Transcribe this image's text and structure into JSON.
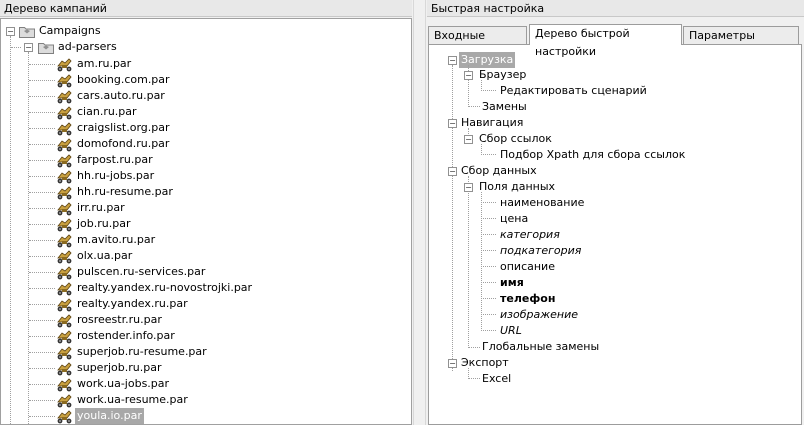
{
  "left_panel": {
    "title": "Дерево кампаний",
    "root": "Campaigns",
    "folder": "ad-parsers",
    "files": [
      "am.ru.par",
      "booking.com.par",
      "cars.auto.ru.par",
      "cian.ru.par",
      "craigslist.org.par",
      "domofond.ru.par",
      "farpost.ru.par",
      "hh.ru-jobs.par",
      "hh.ru-resume.par",
      "irr.ru.par",
      "job.ru.par",
      "m.avito.ru.par",
      "olx.ua.par",
      "pulscen.ru-services.par",
      "realty.yandex.ru-novostrojki.par",
      "realty.yandex.ru.par",
      "rosreestr.ru.par",
      "rostender.info.par",
      "superjob.ru-resume.par",
      "superjob.ru.par",
      "work.ua-jobs.par",
      "work.ua-resume.par",
      "youla.io.par"
    ],
    "selected_file": "youla.io.par"
  },
  "right_panel": {
    "title": "Быстрая настройка",
    "tabs": [
      "Входные данные",
      "Дерево быстрой настройки",
      "Параметры сценария"
    ],
    "active_tab": "Дерево быстрой настройки",
    "tree": {
      "loading": "Загрузка",
      "browser": "Браузер",
      "edit_script": "Редактировать сценарий",
      "replacements": "Замены",
      "navigation": "Навигация",
      "link_collection": "Сбор ссылок",
      "xpath_selection": "Подбор Xpath для сбора ссылок",
      "data_collection": "Сбор данных",
      "data_fields": "Поля данных",
      "fields": [
        "наименование",
        "цена",
        "категория",
        "подкатегория",
        "описание",
        "имя",
        "телефон",
        "изображение",
        "URL"
      ],
      "global_replacements": "Глобальные замены",
      "export": "Экспорт",
      "excel": "Excel"
    }
  }
}
